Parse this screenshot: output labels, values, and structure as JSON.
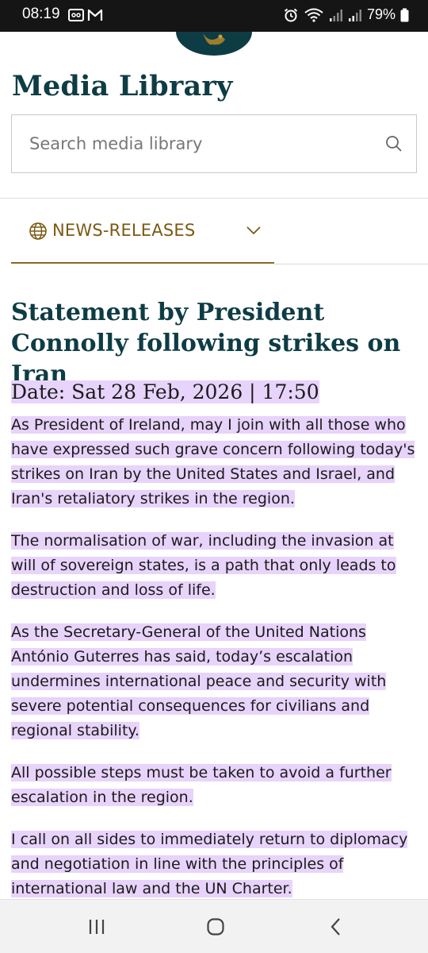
{
  "status_bar": {
    "time": "08:19",
    "battery": "79%"
  },
  "page": {
    "title": "Media Library"
  },
  "search": {
    "placeholder": "Search media library"
  },
  "category": {
    "selected": "NEWS-RELEASES"
  },
  "article": {
    "title": "Statement by President Connolly following strikes on Iran",
    "date": "Date: Sat 28 Feb, 2026 | 17:50",
    "paragraphs": [
      "As President of Ireland, may I join with all those who have expressed such grave concern following today's strikes on Iran by the United States and Israel, and Iran's retaliatory strikes in the region.",
      "The normalisation of war, including the invasion at will of sovereign states, is a path that only leads to destruction and loss of life.",
      "As the Secretary-General of the United Nations António Guterres has said, today’s escalation undermines international peace and security with severe potential consequences for civilians and regional stability.",
      "All possible steps must be taken to avoid a further escalation in the region.",
      "I call on all sides to immediately return to diplomacy and negotiation in line with the principles of international law and the UN Charter."
    ],
    "highlight_color": "#e8d3fb"
  },
  "colors": {
    "heading": "#0e3c44",
    "accent_gold": "#7b5a12"
  }
}
